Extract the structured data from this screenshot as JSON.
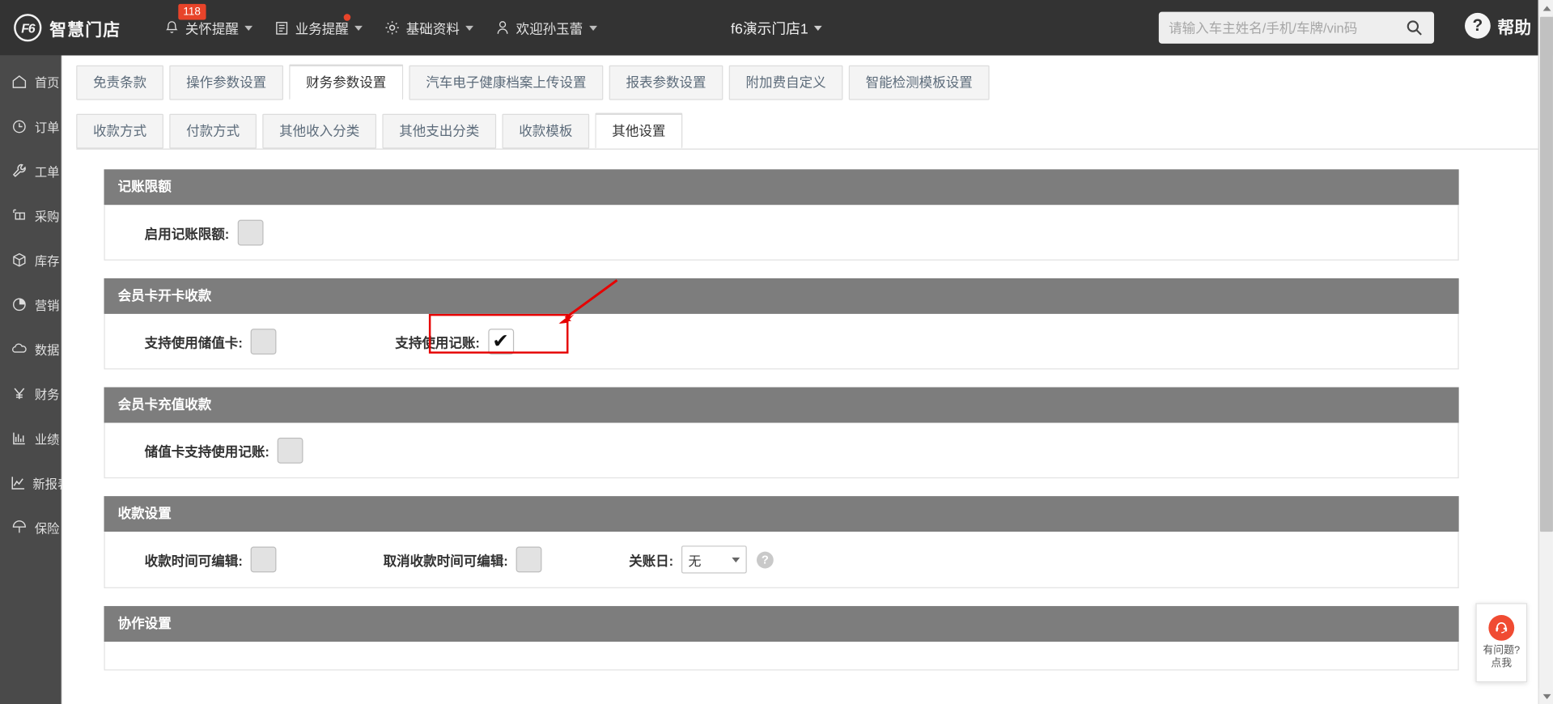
{
  "topbar": {
    "brand_logo_text": "F6",
    "brand_name": "智慧门店",
    "nav": [
      {
        "label": "关怀提醒",
        "icon": "bell-icon",
        "badge": "118",
        "dot": false
      },
      {
        "label": "业务提醒",
        "icon": "list-icon",
        "badge": "",
        "dot": true
      },
      {
        "label": "基础资料",
        "icon": "gear-icon",
        "badge": "",
        "dot": false
      },
      {
        "label": "欢迎孙玉蕾",
        "icon": "user-icon",
        "badge": "",
        "dot": false
      }
    ],
    "store_title": "f6演示门店1",
    "search_placeholder": "请输入车主姓名/手机/车牌/vin码",
    "search_value": "",
    "help_label": "帮助",
    "help_mark": "?"
  },
  "sidebar": {
    "items": [
      {
        "label": "首页",
        "icon": "home-icon"
      },
      {
        "label": "订单",
        "icon": "clock-icon"
      },
      {
        "label": "工单",
        "icon": "wrench-icon"
      },
      {
        "label": "采购",
        "icon": "cart-icon"
      },
      {
        "label": "库存",
        "icon": "box-icon"
      },
      {
        "label": "营销",
        "icon": "pie-icon"
      },
      {
        "label": "数据",
        "icon": "cloud-icon"
      },
      {
        "label": "财务",
        "icon": "yuan-icon"
      },
      {
        "label": "业绩",
        "icon": "bar-chart-icon"
      },
      {
        "label": "新报表",
        "icon": "line-chart-icon"
      },
      {
        "label": "保险",
        "icon": "umbrella-icon"
      }
    ]
  },
  "main_tabs": {
    "items": [
      {
        "label": "免责条款",
        "active": false
      },
      {
        "label": "操作参数设置",
        "active": false
      },
      {
        "label": "财务参数设置",
        "active": true
      },
      {
        "label": "汽车电子健康档案上传设置",
        "active": false
      },
      {
        "label": "报表参数设置",
        "active": false
      },
      {
        "label": "附加费自定义",
        "active": false
      },
      {
        "label": "智能检测模板设置",
        "active": false
      }
    ]
  },
  "sub_tabs": {
    "items": [
      {
        "label": "收款方式",
        "active": false
      },
      {
        "label": "付款方式",
        "active": false
      },
      {
        "label": "其他收入分类",
        "active": false
      },
      {
        "label": "其他支出分类",
        "active": false
      },
      {
        "label": "收款模板",
        "active": false
      },
      {
        "label": "其他设置",
        "active": true
      }
    ]
  },
  "sections": [
    {
      "title": "记账限额",
      "fields": [
        {
          "label": "启用记账限额:",
          "type": "checkbox",
          "checked": false
        }
      ]
    },
    {
      "title": "会员卡开卡收款",
      "fields": [
        {
          "label": "支持使用储值卡:",
          "type": "checkbox",
          "checked": false
        },
        {
          "label": "支持使用记账:",
          "type": "checkbox",
          "checked": true,
          "highlighted": true
        }
      ]
    },
    {
      "title": "会员卡充值收款",
      "fields": [
        {
          "label": "储值卡支持使用记账:",
          "type": "checkbox",
          "checked": false
        }
      ]
    },
    {
      "title": "收款设置",
      "fields": [
        {
          "label": "收款时间可编辑:",
          "type": "checkbox",
          "checked": false
        },
        {
          "label": "取消收款时间可编辑:",
          "type": "checkbox",
          "checked": false
        },
        {
          "label": "关账日:",
          "type": "select",
          "value": "无",
          "help": "?"
        }
      ]
    },
    {
      "title": "协作设置",
      "fields": []
    }
  ],
  "chat_widget": {
    "icon": "headset-icon",
    "line1": "有问题?",
    "line2": "点我"
  },
  "colors": {
    "topbar_bg": "#333333",
    "sidebar_bg": "#4a4a4a",
    "section_header_bg": "#7d7d7d",
    "badge_red": "#e8442a",
    "annotation_red": "#e60000",
    "chat_orange": "#f04b32"
  }
}
